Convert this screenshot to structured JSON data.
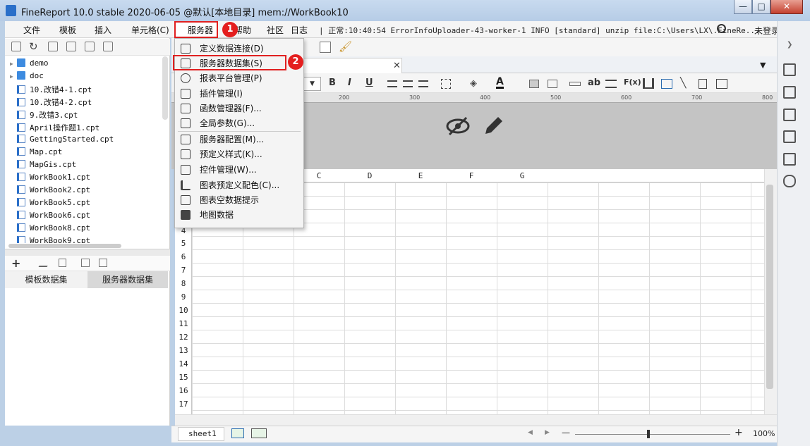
{
  "window": {
    "title": "FineReport 10.0 stable 2020-06-05 @默认[本地目录]    mem://WorkBook10",
    "controls": {
      "minimize": "—",
      "maximize": "□",
      "close": "✕"
    }
  },
  "menubar": {
    "items": [
      "文件",
      "模板",
      "插入",
      "单元格(C)",
      "服务器",
      "帮助",
      "社区",
      "日志"
    ],
    "log_text": "| 正常:10:40:54 ErrorInfoUploader-43-worker-1 INFO [standard] unzip file:C:\\Users\\LX\\.FineRe...",
    "login": "未登录"
  },
  "annotations": {
    "badge1": "1",
    "badge2": "2"
  },
  "file_tree": {
    "items": [
      {
        "label": "demo",
        "type": "folder"
      },
      {
        "label": "doc",
        "type": "folder"
      },
      {
        "label": "10.改错4-1.cpt",
        "type": "cpt"
      },
      {
        "label": "10.改错4-2.cpt",
        "type": "cpt"
      },
      {
        "label": "9.改错3.cpt",
        "type": "cpt"
      },
      {
        "label": "April操作题1.cpt",
        "type": "cpt"
      },
      {
        "label": "GettingStarted.cpt",
        "type": "cpt"
      },
      {
        "label": "Map.cpt",
        "type": "cpt"
      },
      {
        "label": "MapGis.cpt",
        "type": "cpt"
      },
      {
        "label": "WorkBook1.cpt",
        "type": "cpt"
      },
      {
        "label": "WorkBook2.cpt",
        "type": "cpt"
      },
      {
        "label": "WorkBook5.cpt",
        "type": "cpt"
      },
      {
        "label": "WorkBook6.cpt",
        "type": "cpt"
      },
      {
        "label": "WorkBook8.cpt",
        "type": "cpt"
      },
      {
        "label": "WorkBook9.cpt",
        "type": "cpt"
      }
    ]
  },
  "dataset_tabs": {
    "template": "模板数据集",
    "server": "服务器数据集"
  },
  "server_menu": {
    "items": [
      "定义数据连接(D)",
      "服务器数据集(S)",
      "报表平台管理(P)",
      "插件管理(I)",
      "函数管理器(F)...",
      "全局参数(G)...",
      "服务器配置(M)...",
      "预定义样式(K)...",
      "控件管理(W)...",
      "图表预定义配色(C)...",
      "图表空数据提示",
      "地图数据"
    ]
  },
  "format_toolbar": {
    "bold": "B",
    "italic": "I",
    "underline": "U",
    "text_label": "ab",
    "formula": "F(x)"
  },
  "ruler": {
    "ticks": [
      "200",
      "300",
      "400",
      "500",
      "600",
      "700",
      "800"
    ]
  },
  "sheet": {
    "columns": [
      "C",
      "D",
      "E",
      "F",
      "G"
    ],
    "rows": [
      "4",
      "5",
      "6",
      "7",
      "8",
      "9",
      "10",
      "11",
      "12",
      "13",
      "14",
      "15",
      "16",
      "17"
    ]
  },
  "statusbar": {
    "sheet_tab": "sheet1",
    "zoom": "100%",
    "zoom_minus": "—",
    "zoom_plus": "+"
  }
}
